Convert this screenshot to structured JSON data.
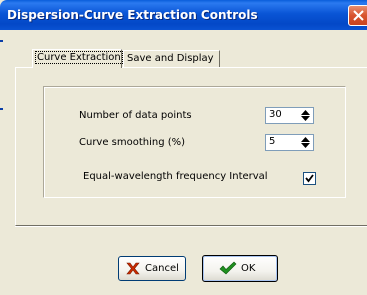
{
  "window": {
    "title": "Dispersion-Curve Extraction Controls"
  },
  "tabs": [
    {
      "label": "Curve Extraction",
      "active": true
    },
    {
      "label": "Save and Display",
      "active": false
    }
  ],
  "fields": {
    "num_points": {
      "label": "Number of data points",
      "value": "30"
    },
    "smoothing": {
      "label": "Curve smoothing (%)",
      "value": "5"
    },
    "equal_wavelength": {
      "label": "Equal-wavelength frequency Interval",
      "checked": true
    }
  },
  "buttons": {
    "cancel": {
      "label": "Cancel",
      "icon": "x-icon"
    },
    "ok": {
      "label": "OK",
      "icon": "checkmark-icon"
    }
  },
  "colors": {
    "titlebar": "#0a55d6",
    "close": "#d8542f",
    "cancel_x": "#cc2a00",
    "ok_check": "#1f8f1f"
  }
}
